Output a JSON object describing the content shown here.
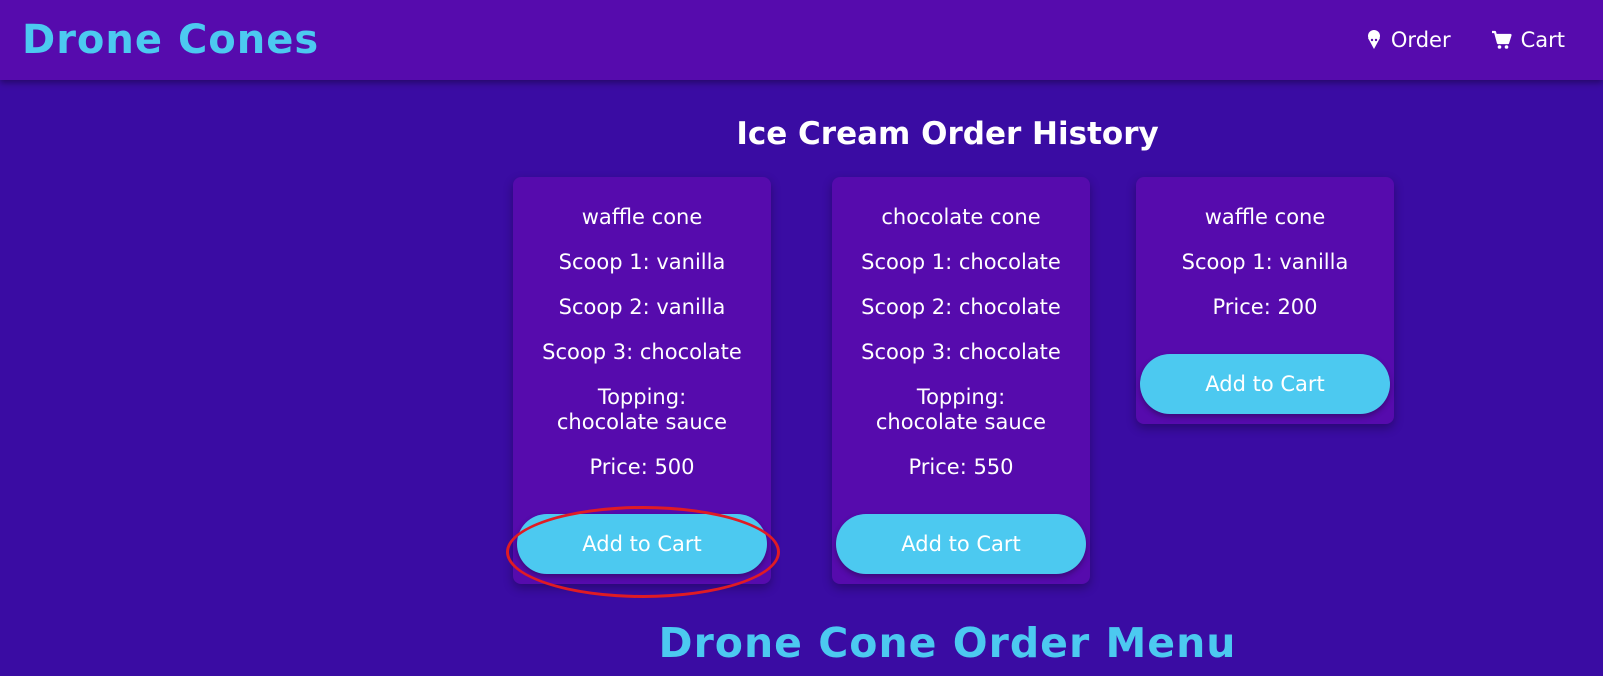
{
  "navbar": {
    "brand": "Drone Cones",
    "links": [
      {
        "label": "Order",
        "icon": "ice-cream-icon"
      },
      {
        "label": "Cart",
        "icon": "cart-icon"
      }
    ]
  },
  "history": {
    "title": "Ice Cream Order History",
    "orders": [
      {
        "cone": "waffle cone",
        "scoop1": "Scoop 1: vanilla",
        "scoop2": "Scoop 2: vanilla",
        "scoop3": "Scoop 3: chocolate",
        "topping": "Topping: chocolate sauce",
        "price": "Price: 500",
        "button": "Add to Cart"
      },
      {
        "cone": "chocolate cone",
        "scoop1": "Scoop 1: chocolate",
        "scoop2": "Scoop 2: chocolate",
        "scoop3": "Scoop 3: chocolate",
        "topping": "Topping: chocolate sauce",
        "price": "Price: 550",
        "button": "Add to Cart"
      },
      {
        "cone": "waffle cone",
        "scoop1": "Scoop 1: vanilla",
        "price": "Price: 200",
        "button": "Add to Cart"
      }
    ]
  },
  "menu": {
    "title": "Drone Cone Order Menu"
  },
  "colors": {
    "background": "#3a0ca3",
    "navbar": "#560bad",
    "card": "#560bad",
    "accent": "#4cc9f0",
    "highlight": "#e01b24"
  }
}
